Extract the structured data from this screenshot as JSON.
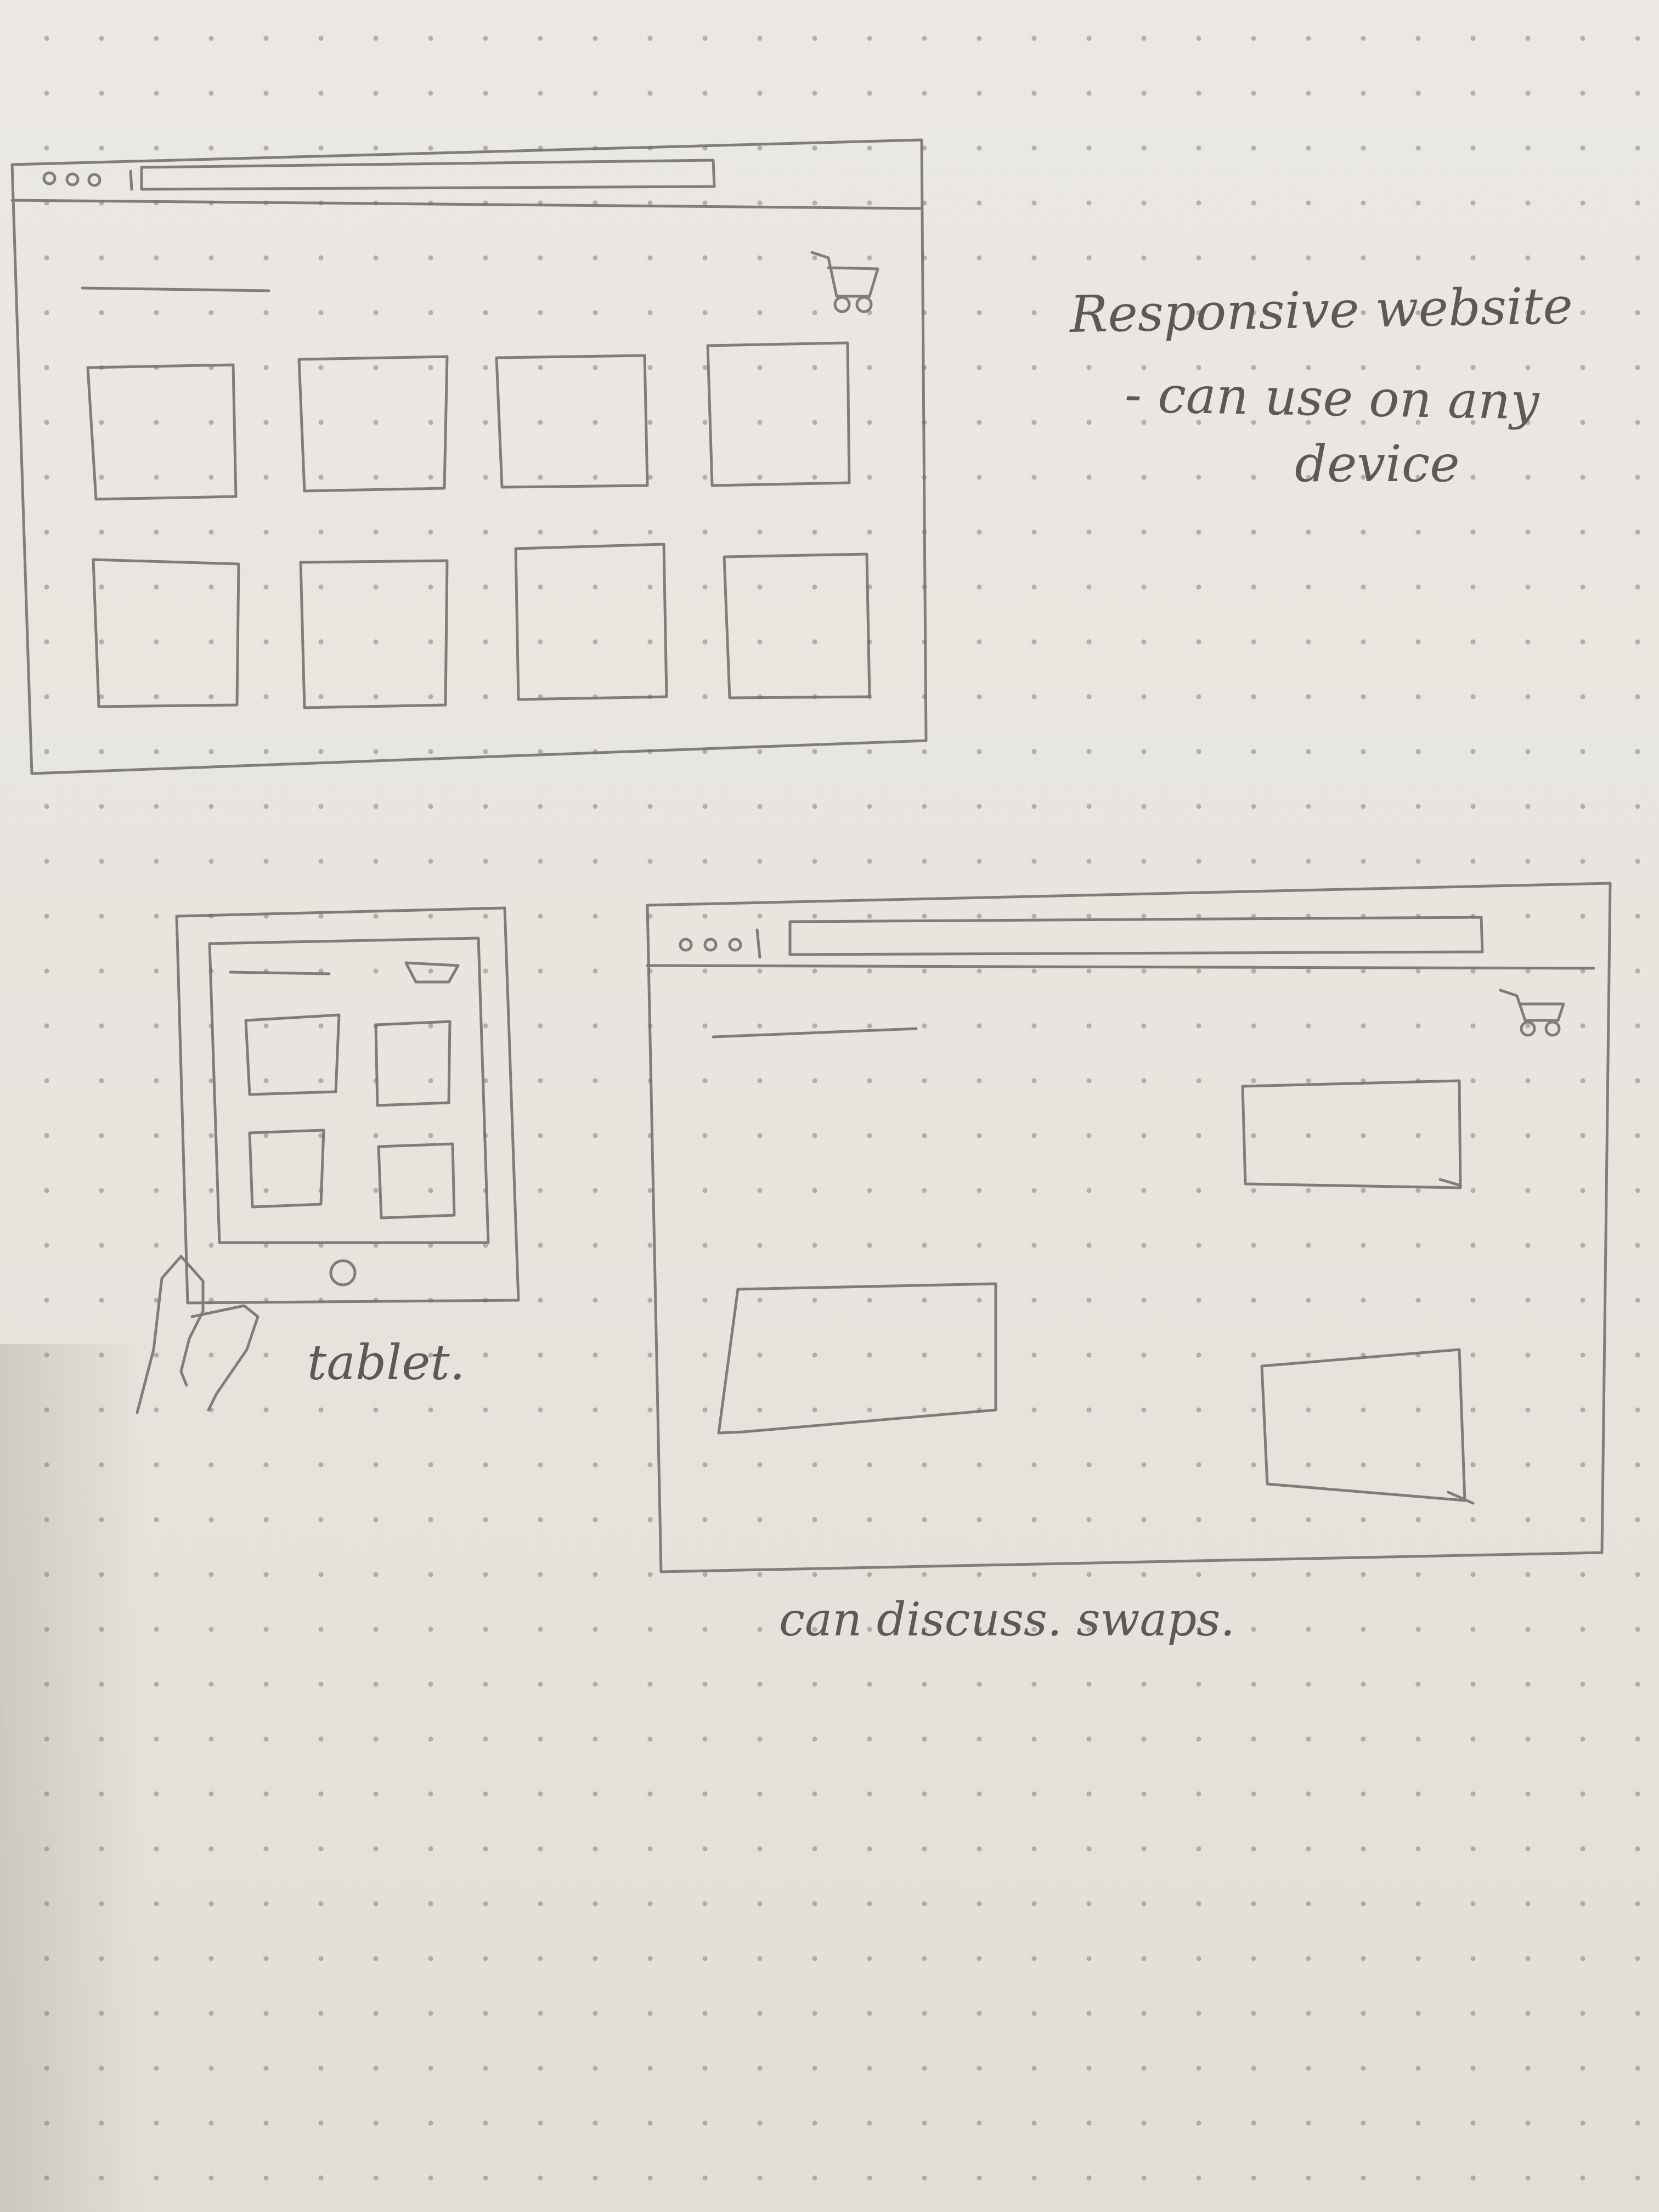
{
  "notes": {
    "responsive_title": "Responsive website",
    "responsive_line2": "- can use on any",
    "responsive_line3": "device",
    "tablet_label": "tablet.",
    "swaps_note": "can discuss. swaps."
  },
  "icons": [
    "cart-icon",
    "window-dots-icon",
    "home-button-icon",
    "hand-icon"
  ],
  "colors": {
    "paper": "#e9e6e0",
    "pencil": "#6f6c67",
    "dot": "#6f6c67"
  }
}
